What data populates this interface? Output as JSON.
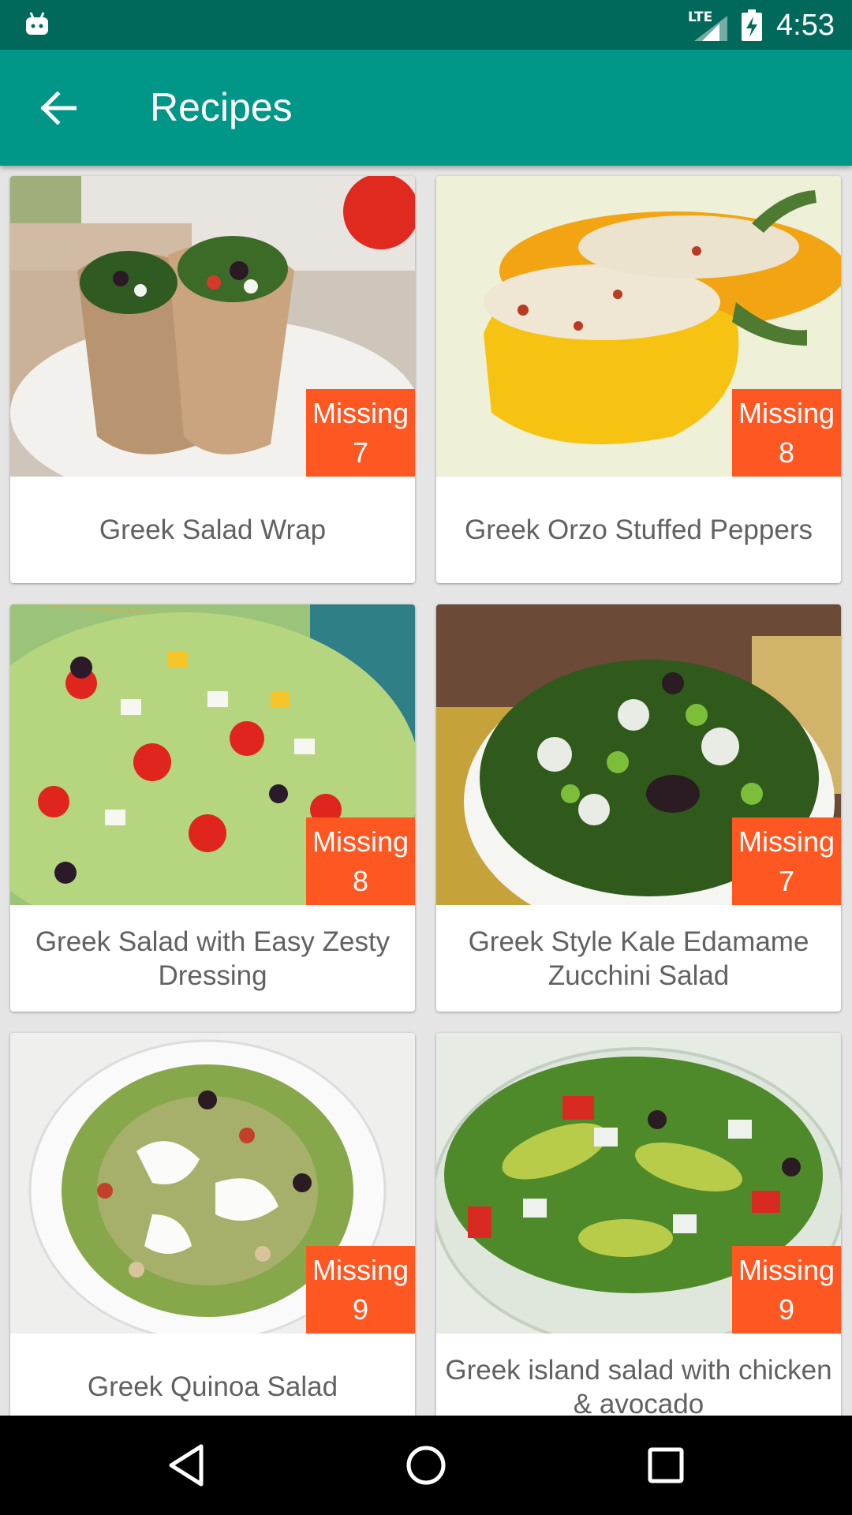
{
  "status_bar": {
    "network": "LTE",
    "time": "4:53"
  },
  "toolbar": {
    "title": "Recipes",
    "back_icon": "arrow-left-icon"
  },
  "recipes": [
    {
      "name": "Greek Salad Wrap",
      "badge_label": "Missing",
      "missing": "7"
    },
    {
      "name": "Greek Orzo Stuffed Peppers",
      "badge_label": "Missing",
      "missing": "8"
    },
    {
      "name": "Greek Salad with Easy Zesty Dressing",
      "badge_label": "Missing",
      "missing": "8"
    },
    {
      "name": "Greek Style Kale Edamame Zucchini Salad",
      "badge_label": "Missing",
      "missing": "7"
    },
    {
      "name": "Greek Quinoa Salad",
      "badge_label": "Missing",
      "missing": "9"
    },
    {
      "name": "Greek island salad with chicken & avocado",
      "badge_label": "Missing",
      "missing": "9"
    }
  ],
  "colors": {
    "primary": "#009688",
    "primary_dark": "#00695c",
    "badge": "#ff5722",
    "text": "#616161"
  },
  "nav": {
    "back": "triangle-back-icon",
    "home": "circle-home-icon",
    "recents": "square-recents-icon"
  }
}
